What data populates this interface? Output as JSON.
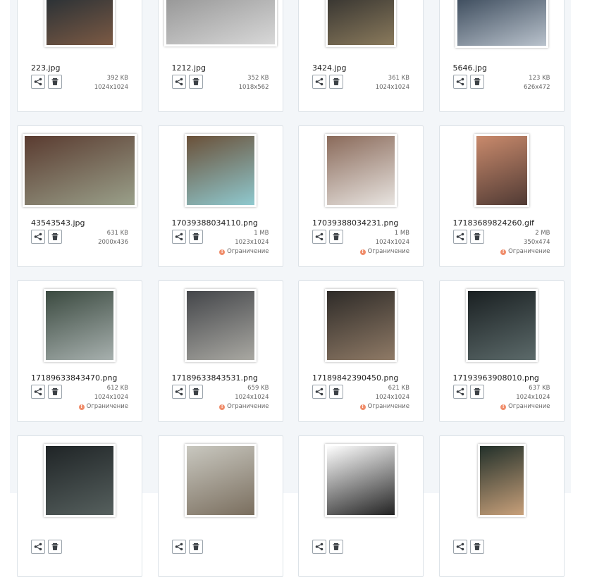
{
  "gallery": {
    "restriction_label": "Ограничение",
    "items": [
      {
        "filename": "223.jpg",
        "size": "392 KB",
        "dimensions": "1024x1024",
        "restricted": false,
        "thumb": {
          "w": 100,
          "h": 90,
          "c1": "#1c2a33",
          "c2": "#7c5a44"
        }
      },
      {
        "filename": "1212.jpg",
        "size": "352 KB",
        "dimensions": "1018x562",
        "restricted": false,
        "thumb": {
          "w": 160,
          "h": 88,
          "c1": "#8f8f8f",
          "c2": "#d8d8d8"
        }
      },
      {
        "filename": "3424.jpg",
        "size": "361 KB",
        "dimensions": "1024x1024",
        "restricted": false,
        "thumb": {
          "w": 100,
          "h": 90,
          "c1": "#2a2a2a",
          "c2": "#8a7a5c"
        }
      },
      {
        "filename": "5646.jpg",
        "size": "123 KB",
        "dimensions": "626x472",
        "restricted": false,
        "thumb": {
          "w": 132,
          "h": 92,
          "c1": "#2a3a4c",
          "c2": "#b9c2cc"
        }
      },
      {
        "filename": "43543543.jpg",
        "size": "631 KB",
        "dimensions": "2000x436",
        "restricted": false,
        "thumb": {
          "w": 162,
          "h": 104,
          "c1": "#5a3b30",
          "c2": "#9aa08a"
        }
      },
      {
        "filename": "17039388034110.png",
        "size": "1 MB",
        "dimensions": "1023x1024",
        "restricted": true,
        "thumb": {
          "w": 102,
          "h": 104,
          "c1": "#6a5038",
          "c2": "#8fc9cf"
        }
      },
      {
        "filename": "17039388034231.png",
        "size": "1 MB",
        "dimensions": "1024x1024",
        "restricted": true,
        "thumb": {
          "w": 102,
          "h": 104,
          "c1": "#8a6a5a",
          "c2": "#e8e4e0"
        }
      },
      {
        "filename": "17183689824260.gif",
        "size": "2 MB",
        "dimensions": "350x474",
        "restricted": true,
        "thumb": {
          "w": 78,
          "h": 104,
          "c1": "#c98a6c",
          "c2": "#503a34"
        }
      },
      {
        "filename": "17189633843470.png",
        "size": "612 KB",
        "dimensions": "1024x1024",
        "restricted": true,
        "thumb": {
          "w": 102,
          "h": 104,
          "c1": "#3b4a40",
          "c2": "#a7b0ae"
        }
      },
      {
        "filename": "17189633843531.png",
        "size": "659 KB",
        "dimensions": "1024x1024",
        "restricted": true,
        "thumb": {
          "w": 102,
          "h": 104,
          "c1": "#44464a",
          "c2": "#a9a8a2"
        }
      },
      {
        "filename": "17189842390450.png",
        "size": "621 KB",
        "dimensions": "1024x1024",
        "restricted": true,
        "thumb": {
          "w": 102,
          "h": 104,
          "c1": "#2e2b28",
          "c2": "#8f7a66"
        }
      },
      {
        "filename": "17193963908010.png",
        "size": "637 KB",
        "dimensions": "1024x1024",
        "restricted": true,
        "thumb": {
          "w": 102,
          "h": 104,
          "c1": "#1a2022",
          "c2": "#5c6a6a"
        }
      },
      {
        "filename": "",
        "size": "",
        "dimensions": "",
        "restricted": false,
        "thumb": {
          "w": 102,
          "h": 104,
          "c1": "#1f2426",
          "c2": "#56605e"
        }
      },
      {
        "filename": "",
        "size": "",
        "dimensions": "",
        "restricted": false,
        "thumb": {
          "w": 102,
          "h": 104,
          "c1": "#c9c8c0",
          "c2": "#7a6e5e"
        }
      },
      {
        "filename": "",
        "size": "",
        "dimensions": "",
        "restricted": false,
        "thumb": {
          "w": 102,
          "h": 104,
          "c1": "#ffffff",
          "c2": "#222222"
        }
      },
      {
        "filename": "",
        "size": "",
        "dimensions": "",
        "restricted": false,
        "thumb": {
          "w": 68,
          "h": 104,
          "c1": "#22302a",
          "c2": "#c8a07a"
        }
      }
    ]
  },
  "colors": {
    "panel_bg": "#f3f6f9",
    "card_border": "#dde3e8",
    "warning": "#f08d6b"
  },
  "icons": {
    "share": "share-icon",
    "delete": "trash-icon",
    "warning": "warning-icon"
  }
}
